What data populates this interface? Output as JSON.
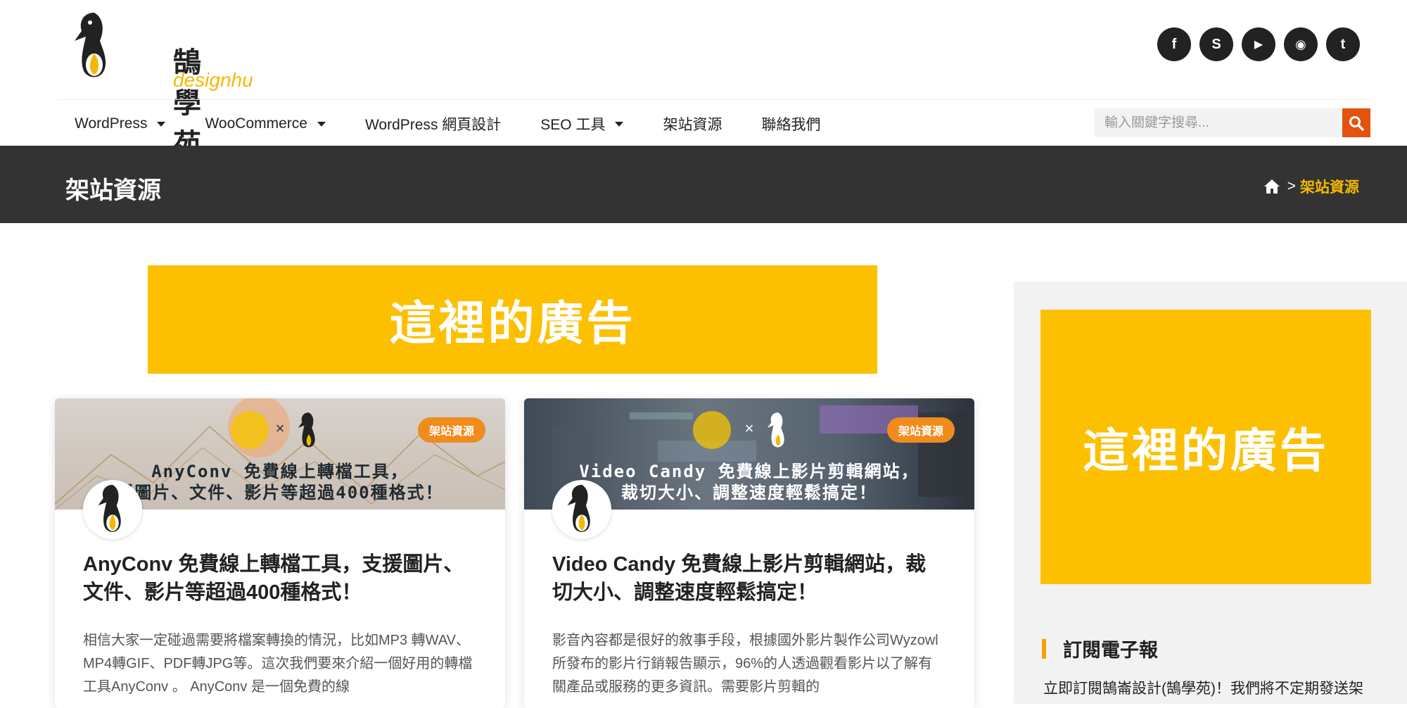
{
  "logo": {
    "name": "鵠學苑",
    "domain": "designhu"
  },
  "social": [
    {
      "icon": "facebook-icon",
      "glyph": "f"
    },
    {
      "icon": "skype-icon",
      "glyph": "S"
    },
    {
      "icon": "youtube-icon",
      "glyph": "▶"
    },
    {
      "icon": "rss-icon",
      "glyph": "◉"
    },
    {
      "icon": "twitter-icon",
      "glyph": "t"
    }
  ],
  "nav": [
    {
      "label": "WordPress",
      "dropdown": true
    },
    {
      "label": "WooCommerce",
      "dropdown": true
    },
    {
      "label": "WordPress 網頁設計",
      "dropdown": false
    },
    {
      "label": "SEO 工具",
      "dropdown": true
    },
    {
      "label": "架站資源",
      "dropdown": false
    },
    {
      "label": "聯絡我們",
      "dropdown": false
    }
  ],
  "search": {
    "placeholder": "輸入關鍵字搜尋..."
  },
  "titlebar": {
    "title": "架站資源",
    "breadcrumb_separator": ">",
    "breadcrumb_current": "架站資源"
  },
  "ads": {
    "main_text": "這裡的廣告",
    "side_text": "這裡的廣告"
  },
  "cards": [
    {
      "badge": "架站資源",
      "thumb_x": "×",
      "thumb_line1": "AnyConv 免費線上轉檔工具，",
      "thumb_line2": "援圖片、文件、影片等超過400種格式！",
      "title": "AnyConv 免費線上轉檔工具，支援圖片、文件、影片等超過400種格式！",
      "excerpt": "相信大家一定碰過需要將檔案轉換的情況，比如MP3 轉WAV、MP4轉GIF、PDF轉JPG等。這次我們要來介紹一個好用的轉檔工具AnyConv 。 AnyConv 是一個免費的線"
    },
    {
      "badge": "架站資源",
      "thumb_x": "×",
      "thumb_line1": "Video Candy 免費線上影片剪輯網站，",
      "thumb_line2": "裁切大小、調整速度輕鬆搞定！",
      "title": "Video Candy 免費線上影片剪輯網站，裁切大小、調整速度輕鬆搞定！",
      "excerpt": "影音內容都是很好的敘事手段，根據國外影片製作公司Wyzowl所發布的影片行銷報告顯示，96%的人透過觀看影片以了解有關產品或服務的更多資訊。需要影片剪輯的"
    }
  ],
  "sidebar": {
    "subscribe_title": "訂閱電子報",
    "subscribe_desc": "立即訂閱鵠崙設計(鵠學苑)！我們將不定期發送架"
  },
  "colors": {
    "accent": "#fdc000",
    "search_btn": "#e3530d",
    "badge": "#f08b1d",
    "titlebar": "#333333"
  }
}
